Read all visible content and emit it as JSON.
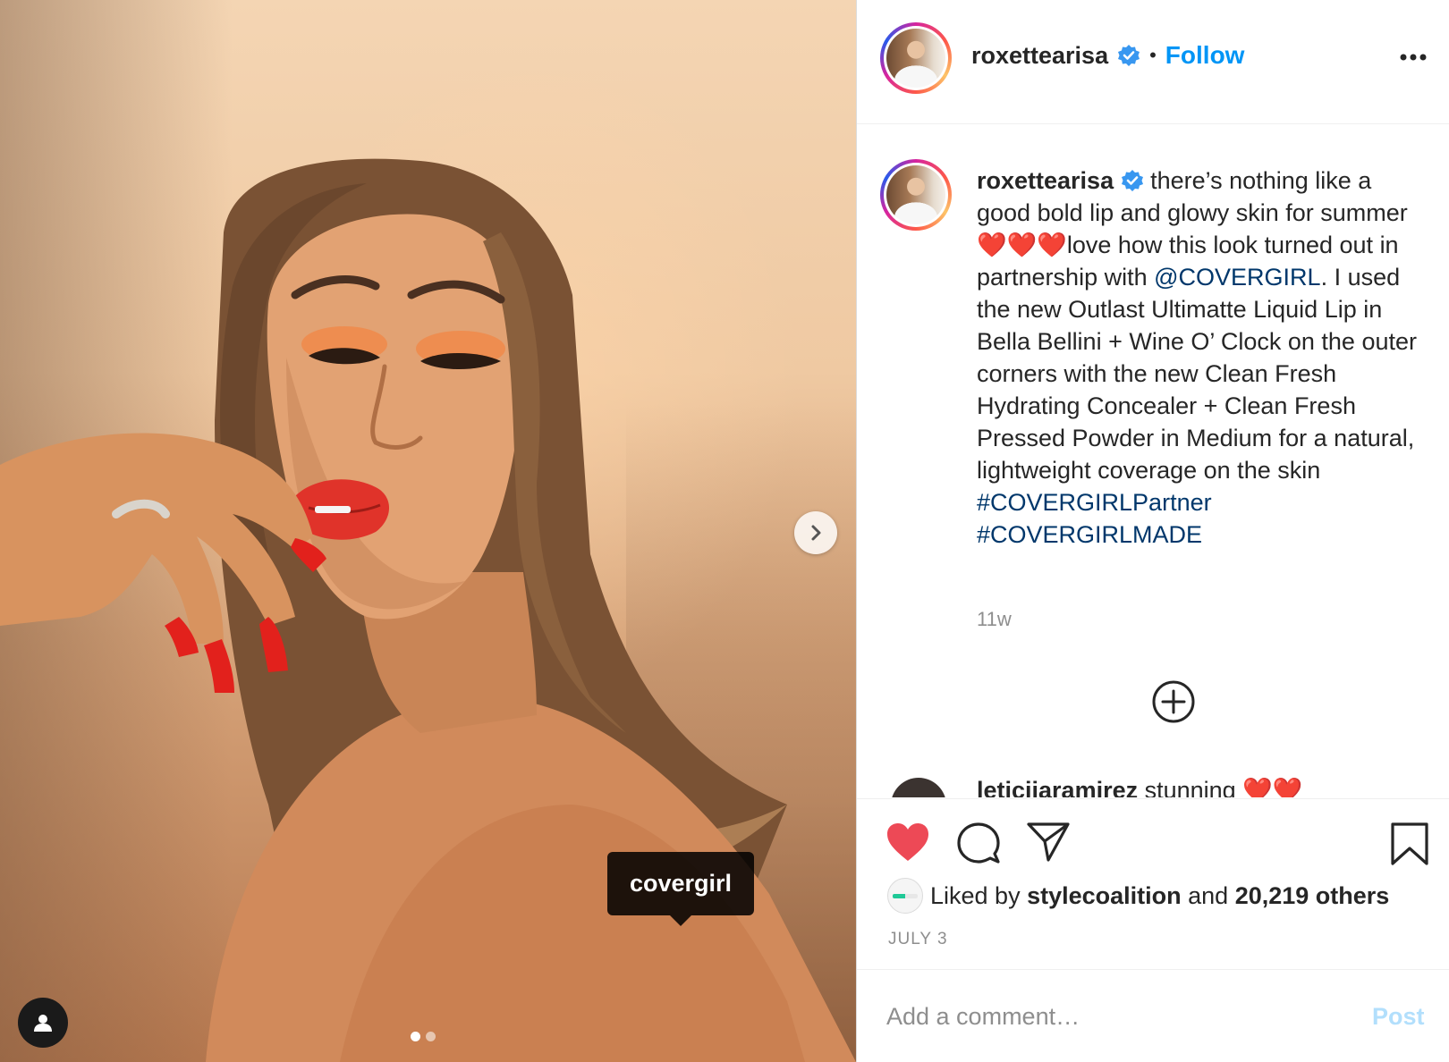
{
  "post": {
    "username": "roxettearisa",
    "follow_label": "Follow",
    "separator": "•",
    "photo_tag": "covergirl",
    "carousel": {
      "count": 2,
      "active_index": 0
    }
  },
  "caption": {
    "username": "roxettearisa",
    "text_1": " there’s nothing like a good bold lip and glowy skin for summer ❤️❤️❤️love how this look turned out in partnership with ",
    "mention": "@COVERGIRL",
    "text_2": ". I used the new Outlast Ultimatte Liquid Lip in Bella Bellini + Wine O’ Clock on the outer corners with the new Clean Fresh Hydrating Concealer + Clean Fresh Pressed Powder in Medium for a natural, lightweight coverage on the skin ",
    "hashtag_1": "#COVERGIRLPartner",
    "hashtag_2": "#COVERGIRLMADE",
    "time": "11w"
  },
  "comment_peek": {
    "username": "leticiiaramirez",
    "text": " stunning ❤️❤️"
  },
  "actions": {
    "liked": true,
    "liked_by_prefix": "Liked by ",
    "liked_by_user": "stylecoalition",
    "liked_by_middle": " and ",
    "liked_by_count": "20,219 others",
    "date": "JULY 3"
  },
  "comment_box": {
    "placeholder": "Add a comment…",
    "post_label": "Post"
  },
  "colors": {
    "link": "#00376b",
    "follow": "#0095f6",
    "heart": "#ed4956",
    "verified": "#3897f0"
  },
  "icons": [
    "verified-badge-icon",
    "more-options-icon",
    "chevron-right-icon",
    "user-tag-icon",
    "add-circle-icon",
    "heart-icon",
    "comment-icon",
    "share-icon",
    "bookmark-icon"
  ]
}
